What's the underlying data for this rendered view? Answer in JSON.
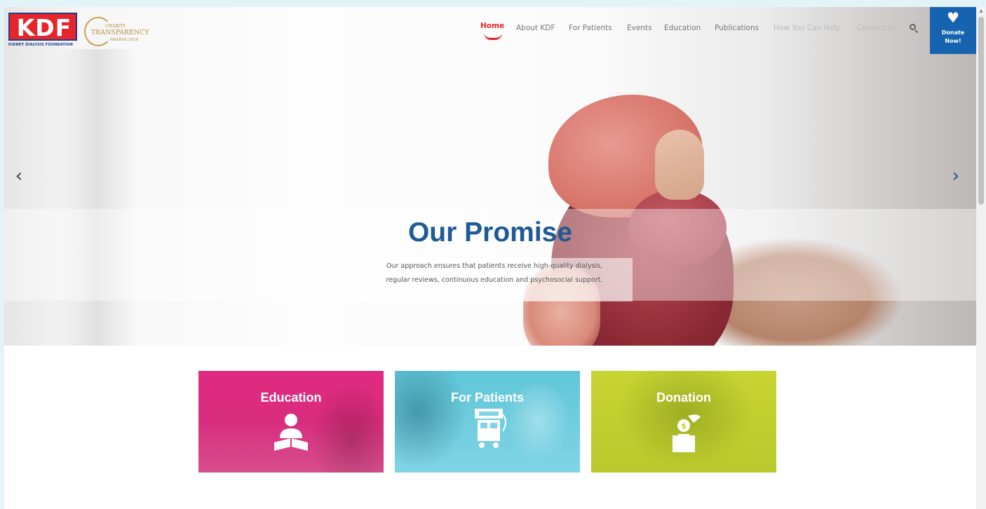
{
  "header": {
    "logo_text": "KDF",
    "logo_subtitle": "KIDNEY DIALYSIS FOUNDATION",
    "award_lines": [
      "CHARITY",
      "TRANSPARENCY",
      "AWARDS 2016"
    ],
    "nav": [
      {
        "label": "Home",
        "active": true
      },
      {
        "label": "About KDF"
      },
      {
        "label": "For Patients"
      },
      {
        "label": "Events"
      },
      {
        "label": "Education"
      },
      {
        "label": "Publications"
      },
      {
        "label": "How You Can Help"
      },
      {
        "label": "Contact Us"
      }
    ],
    "search_icon": "search-icon",
    "donate": {
      "line1": "Donate",
      "line2": "Now!",
      "icon": "heart-icon"
    }
  },
  "hero": {
    "title": "Our Promise",
    "text_line1": "Our approach ensures that patients receive high-quality dialysis,",
    "text_line2": "regular reviews, continuous education and psychosocial support.",
    "prev_arrow": "‹",
    "next_arrow": "›"
  },
  "tiles": [
    {
      "title": "Education",
      "icon": "reading-person-icon",
      "color": "#e02a82"
    },
    {
      "title": "For Patients",
      "icon": "dialysis-machine-icon",
      "color": "#6fcfe0"
    },
    {
      "title": "Donation",
      "icon": "donation-box-icon",
      "color": "#c2cf30"
    }
  ],
  "colors": {
    "brand_red": "#e02826",
    "brand_blue": "#1664b0",
    "title_blue": "#1e5a96"
  }
}
